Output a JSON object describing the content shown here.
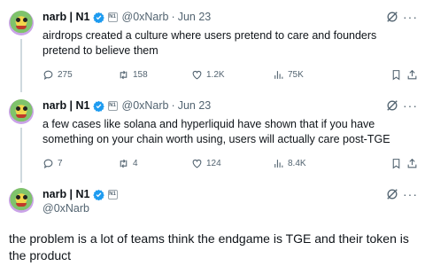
{
  "user": {
    "name": "narb | N1",
    "handle": "@0xNarb",
    "affiliate_badge": "N1"
  },
  "tweets": [
    {
      "date": "Jun 23",
      "text": "airdrops created a culture where users pretend to care and founders pretend to believe them",
      "replies": "275",
      "retweets": "158",
      "likes": "1.2K",
      "views": "75K"
    },
    {
      "date": "Jun 23",
      "text": "a few cases like solana and hyperliquid have shown that if you have something on your chain worth using, users will actually care post-TGE",
      "replies": "7",
      "retweets": "4",
      "likes": "124",
      "views": "8.4K"
    }
  ],
  "main_tweet": {
    "text": "the problem is a lot of teams think the endgame is TGE and their token is the product"
  },
  "separators": {
    "dot": "·",
    "more": "···"
  },
  "colors": {
    "verified": "#1d9bf0",
    "muted": "#536471",
    "text": "#0f1419",
    "thread_line": "#cfd9de"
  },
  "icons": [
    "verified-badge-icon",
    "grok-icon",
    "more-icon",
    "reply-icon",
    "retweet-icon",
    "like-icon",
    "views-icon",
    "bookmark-icon",
    "share-icon"
  ]
}
